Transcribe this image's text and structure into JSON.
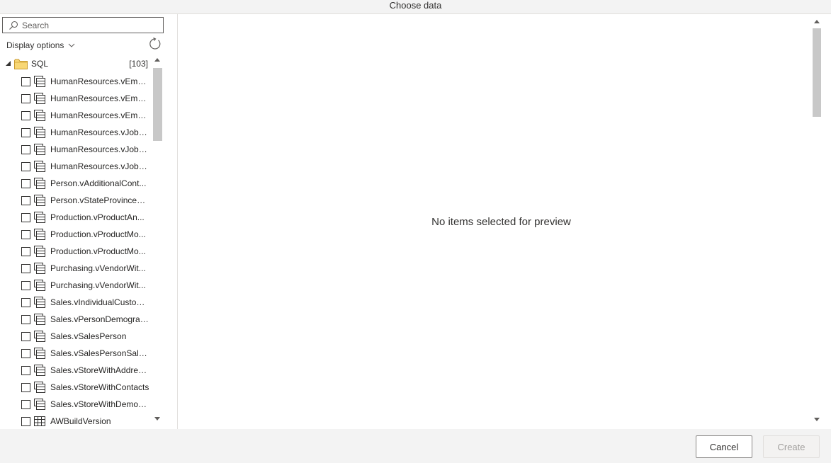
{
  "window": {
    "title": "Choose data"
  },
  "navigator": {
    "search_placeholder": "Search",
    "display_options_label": "Display options",
    "root": {
      "label": "SQL",
      "count": "[103]"
    },
    "items": [
      {
        "label": "HumanResources.vEmpl...",
        "icon": "view-icon"
      },
      {
        "label": "HumanResources.vEmpl...",
        "icon": "view-icon"
      },
      {
        "label": "HumanResources.vEmpl...",
        "icon": "view-icon"
      },
      {
        "label": "HumanResources.vJobC...",
        "icon": "view-icon"
      },
      {
        "label": "HumanResources.vJobC...",
        "icon": "view-icon"
      },
      {
        "label": "HumanResources.vJobC...",
        "icon": "view-icon"
      },
      {
        "label": "Person.vAdditionalCont...",
        "icon": "view-icon"
      },
      {
        "label": "Person.vStateProvinceC...",
        "icon": "view-icon"
      },
      {
        "label": "Production.vProductAn...",
        "icon": "view-icon"
      },
      {
        "label": "Production.vProductMo...",
        "icon": "view-icon"
      },
      {
        "label": "Production.vProductMo...",
        "icon": "view-icon"
      },
      {
        "label": "Purchasing.vVendorWit...",
        "icon": "view-icon"
      },
      {
        "label": "Purchasing.vVendorWit...",
        "icon": "view-icon"
      },
      {
        "label": "Sales.vIndividualCustomer",
        "icon": "view-icon"
      },
      {
        "label": "Sales.vPersonDemograp...",
        "icon": "view-icon"
      },
      {
        "label": "Sales.vSalesPerson",
        "icon": "view-icon"
      },
      {
        "label": "Sales.vSalesPersonSales...",
        "icon": "view-icon"
      },
      {
        "label": "Sales.vStoreWithAddres...",
        "icon": "view-icon"
      },
      {
        "label": "Sales.vStoreWithContacts",
        "icon": "view-icon"
      },
      {
        "label": "Sales.vStoreWithDemog...",
        "icon": "view-icon"
      },
      {
        "label": "AWBuildVersion",
        "icon": "table-icon"
      }
    ]
  },
  "preview": {
    "empty_message": "No items selected for preview"
  },
  "footer": {
    "cancel_label": "Cancel",
    "create_label": "Create"
  }
}
